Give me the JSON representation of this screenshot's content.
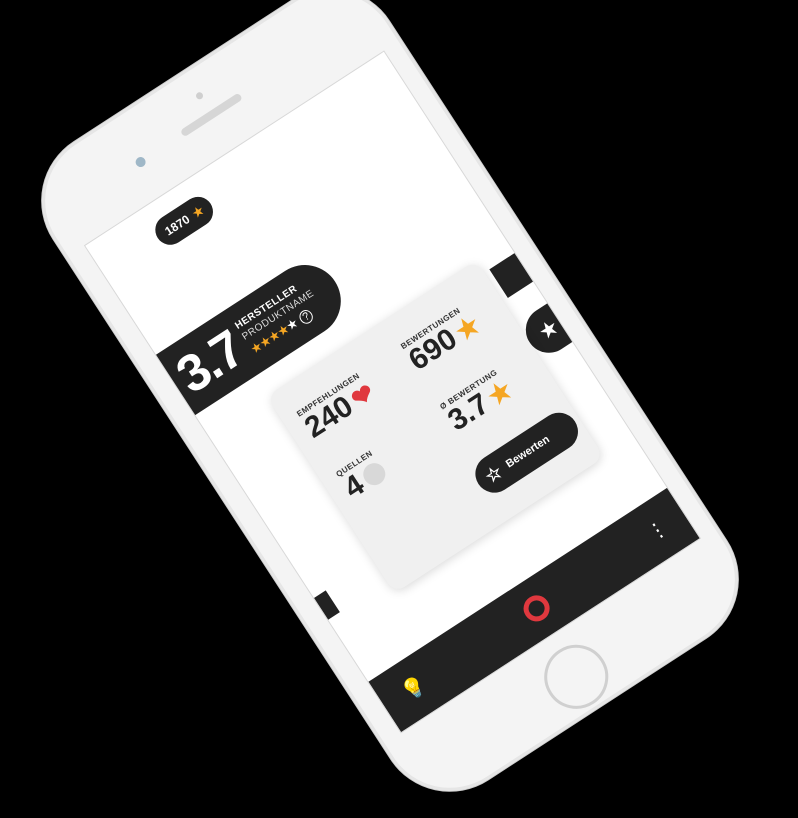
{
  "top_pill": {
    "count": "1870",
    "star": "★"
  },
  "banner": {
    "score": "3.7",
    "brand": "HERSTELLER",
    "product": "PRODUKTNAME",
    "stars_filled": "★★★★",
    "stars_empty": "★",
    "help": "?"
  },
  "card": {
    "recommendations_label": "EMPFEHLUNGEN",
    "recommendations_value": "240",
    "sources_label": "QUELLEN",
    "sources_value": "4",
    "reviews_label": "BEWERTUNGEN",
    "reviews_value": "690",
    "avg_label": "Ø BEWERTUNG",
    "avg_value": "3.7",
    "rate_button": "Bewerten"
  },
  "icons": {
    "heart": "❤",
    "star": "★",
    "outline_star": "☆",
    "bulb": "💡",
    "more": "⋮"
  },
  "colors": {
    "accent": "#f5a623",
    "red": "#e0383e",
    "dark": "#222222"
  }
}
